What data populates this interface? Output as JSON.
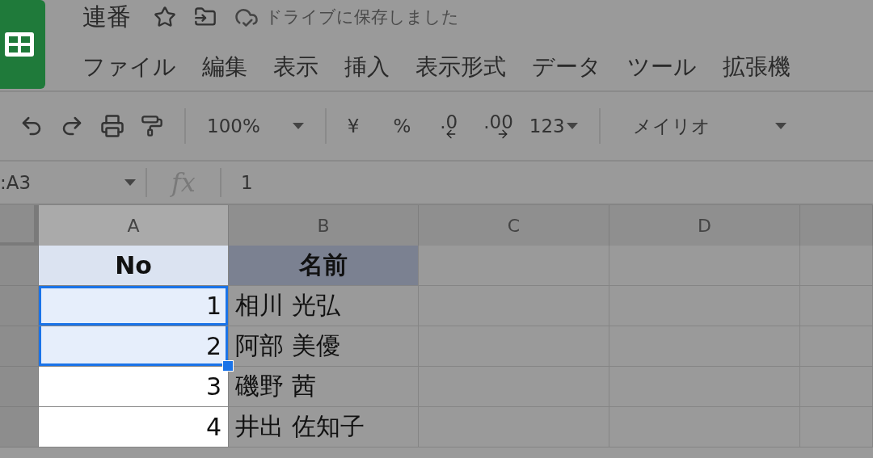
{
  "document": {
    "title": "連番",
    "save_status": "ドライブに保存しました"
  },
  "menu": [
    "ファイル",
    "編集",
    "表示",
    "挿入",
    "表示形式",
    "データ",
    "ツール",
    "拡張機"
  ],
  "toolbar": {
    "zoom": "100%",
    "currency": "¥",
    "percent": "%",
    "decrease_decimal": ".0",
    "increase_decimal": ".00",
    "number_format": "123",
    "font": "メイリオ"
  },
  "formula_bar": {
    "name_box": ":A3",
    "fx": "fx",
    "value": "1"
  },
  "columns": [
    "A",
    "B",
    "C",
    "D"
  ],
  "rows": [
    {
      "kind": "header",
      "selected": false,
      "cells": [
        "No",
        "名前"
      ]
    },
    {
      "kind": "data",
      "selected": true,
      "cells": [
        "1",
        "相川 光弘"
      ]
    },
    {
      "kind": "data",
      "selected": true,
      "cells": [
        "2",
        "阿部 美優"
      ]
    },
    {
      "kind": "data",
      "selected": false,
      "cells": [
        "3",
        "磯野 茜"
      ]
    },
    {
      "kind": "data",
      "selected": false,
      "cells": [
        "4",
        "井出 佐知子"
      ]
    }
  ]
}
